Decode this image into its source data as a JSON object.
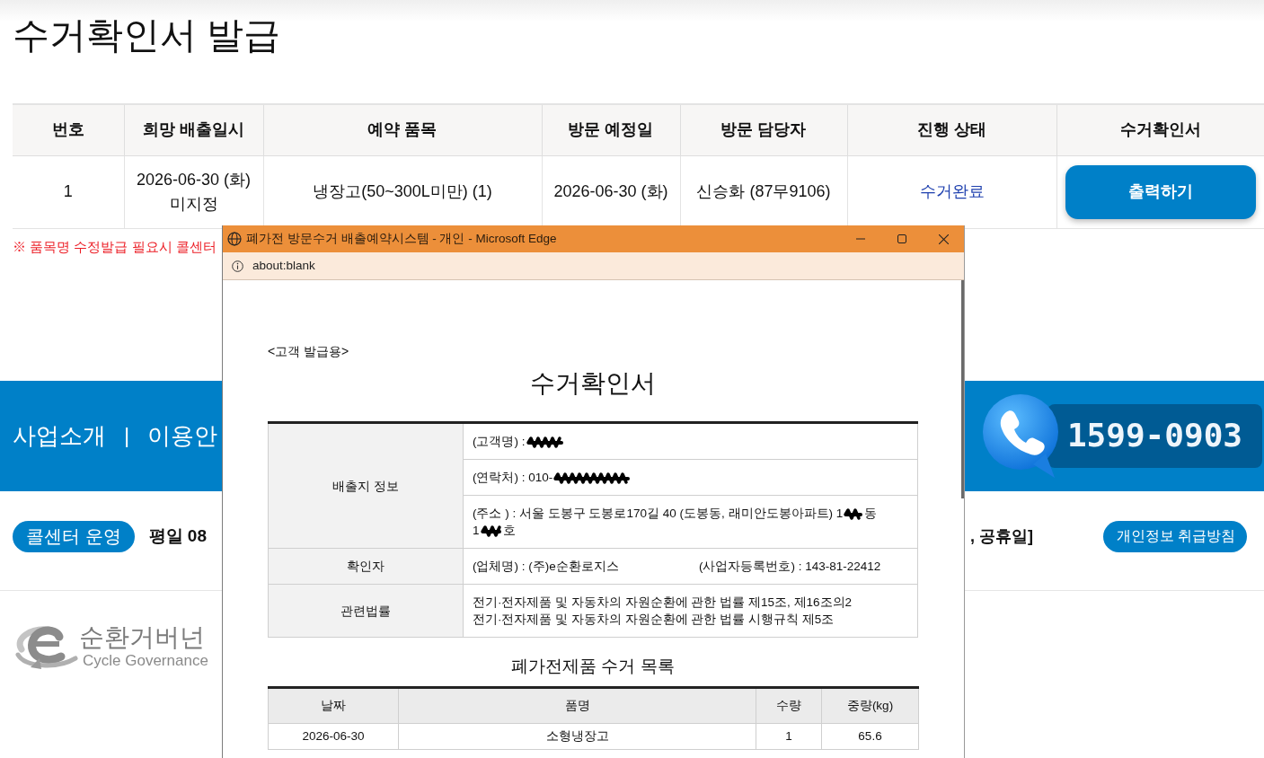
{
  "page": {
    "title": "수거확인서 발급"
  },
  "pickup_table": {
    "columns": [
      "번호",
      "희망 배출일시",
      "예약 품목",
      "방문 예정일",
      "방문 담당자",
      "진행 상태",
      "수거확인서"
    ],
    "rows": [
      {
        "number": "1",
        "desired_datetime": [
          "2026-06-30 (화)",
          "미지정"
        ],
        "item": "냉장고(50~300L미만) (1)",
        "visit_date": "2026-06-30 (화)",
        "visitor": "신승화 (87무9106)",
        "status": "수거완료",
        "certificate_button": "출력하기"
      }
    ]
  },
  "notice": "※ 품목명 수정발급 필요시 콜센터",
  "banner": {
    "menu": [
      {
        "kind": "link",
        "text": "사업소개"
      },
      {
        "kind": "separator",
        "text": "|"
      },
      {
        "kind": "link",
        "text": "이용안"
      }
    ],
    "phone": "1599-0903"
  },
  "info_row": {
    "call_center_button": "콜센터 운영",
    "hours_start": "평일 08",
    "hours_end": ", 공휴일]",
    "privacy_button": "개인정보 취급방침"
  },
  "logo": {
    "name": "순환거버넌",
    "tagline": "Cycle Governance"
  },
  "popup": {
    "title": "폐가전 방문수거 배출예약시스템 - 개인 - Microsoft Edge",
    "address": "about:blank",
    "copy_label": "<고객 발급용>",
    "doc_title": "수거확인서",
    "info_table": [
      {
        "label": "배출지 정보",
        "entries": [
          [
            {
              "kind": "text",
              "text": "(고객명) :"
            },
            {
              "kind": "redacted"
            }
          ],
          [
            {
              "kind": "text",
              "text": "(연락처) : 010-"
            },
            {
              "kind": "redacted"
            }
          ],
          [
            {
              "kind": "text",
              "text": "(주소 ) : 서울 도봉구 도봉로170길 40 (도봉동, 래미안도봉아파트) 1"
            },
            {
              "kind": "redacted"
            },
            {
              "kind": "text",
              "text": "동"
            },
            {
              "kind": "break"
            },
            {
              "kind": "text",
              "text": "1"
            },
            {
              "kind": "redacted"
            },
            {
              "kind": "text",
              "text": "호"
            }
          ]
        ]
      },
      {
        "label": "확인자",
        "entries": [
          [
            {
              "kind": "field",
              "text": "(업체명) : (주)e순환로지스"
            },
            {
              "kind": "field",
              "text": "(사업자등록번호) : 143-81-22412"
            }
          ]
        ]
      },
      {
        "label": "관련법률",
        "entries": [
          [
            {
              "kind": "text",
              "text": "전기·전자제품 및 자동차의 자원순환에 관한 법률 제15조, 제16조의2"
            },
            {
              "kind": "break"
            },
            {
              "kind": "text",
              "text": "전기·전자제품 및 자동차의 자원순환에 관한 법률 시행규칙 제5조"
            }
          ]
        ]
      }
    ],
    "list_title": "폐가전제품 수거 목록",
    "list_table": {
      "columns": [
        "날짜",
        "품명",
        "수량",
        "중량(kg)"
      ],
      "rows": [
        [
          "2026-06-30",
          "소형냉장고",
          "1",
          "65.6"
        ]
      ]
    }
  }
}
